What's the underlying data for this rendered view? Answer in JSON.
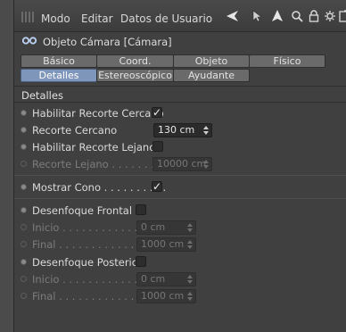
{
  "menubar": {
    "items": [
      "Modo",
      "Editar",
      "Datos de Usuario"
    ],
    "icons": [
      "back-arrow-icon",
      "cursor-icon",
      "navigate-up-icon",
      "lock-icon",
      "settings-icon",
      "new-panel-icon"
    ]
  },
  "title": "Objeto Cámara [Cámara]",
  "tabs": {
    "row1": [
      "Básico",
      "Coord.",
      "Objeto",
      "Físico"
    ],
    "row2": [
      "Detalles",
      "Estereoscópico",
      "Ayudante"
    ],
    "active": "Detalles"
  },
  "section": "Detalles",
  "params": {
    "near_clip_enable": {
      "label": "Habilitar Recorte Cercano",
      "checked": true
    },
    "near_clip": {
      "label": "Recorte Cercano",
      "value": "130 cm"
    },
    "far_clip_enable": {
      "label": "Habilitar Recorte Lejano",
      "checked": false
    },
    "far_clip": {
      "label": "Recorte Lejano . . . . . . . . .",
      "value": "10000 cm"
    },
    "show_cone": {
      "label": "Mostrar Cono . . . . . . . . . .",
      "checked": true
    },
    "front_blur": {
      "label": "Desenfoque Frontal",
      "checked": false
    },
    "front_start": {
      "label": "Inicio . . . . . . . . . . . . .",
      "value": "0 cm"
    },
    "front_end": {
      "label": "Final . . . . . . . . . . . . . .",
      "value": "1000 cm"
    },
    "rear_blur": {
      "label": "Desenfoque Posterior",
      "checked": false
    },
    "rear_start": {
      "label": "Inicio . . . . . . . . . . . . .",
      "value": "0 cm"
    },
    "rear_end": {
      "label": "Final . . . . . . . . . . . . . .",
      "value": "1000 cm"
    }
  },
  "colors": {
    "accent_tab": "#7f96bb",
    "panel_bg": "#404040"
  }
}
